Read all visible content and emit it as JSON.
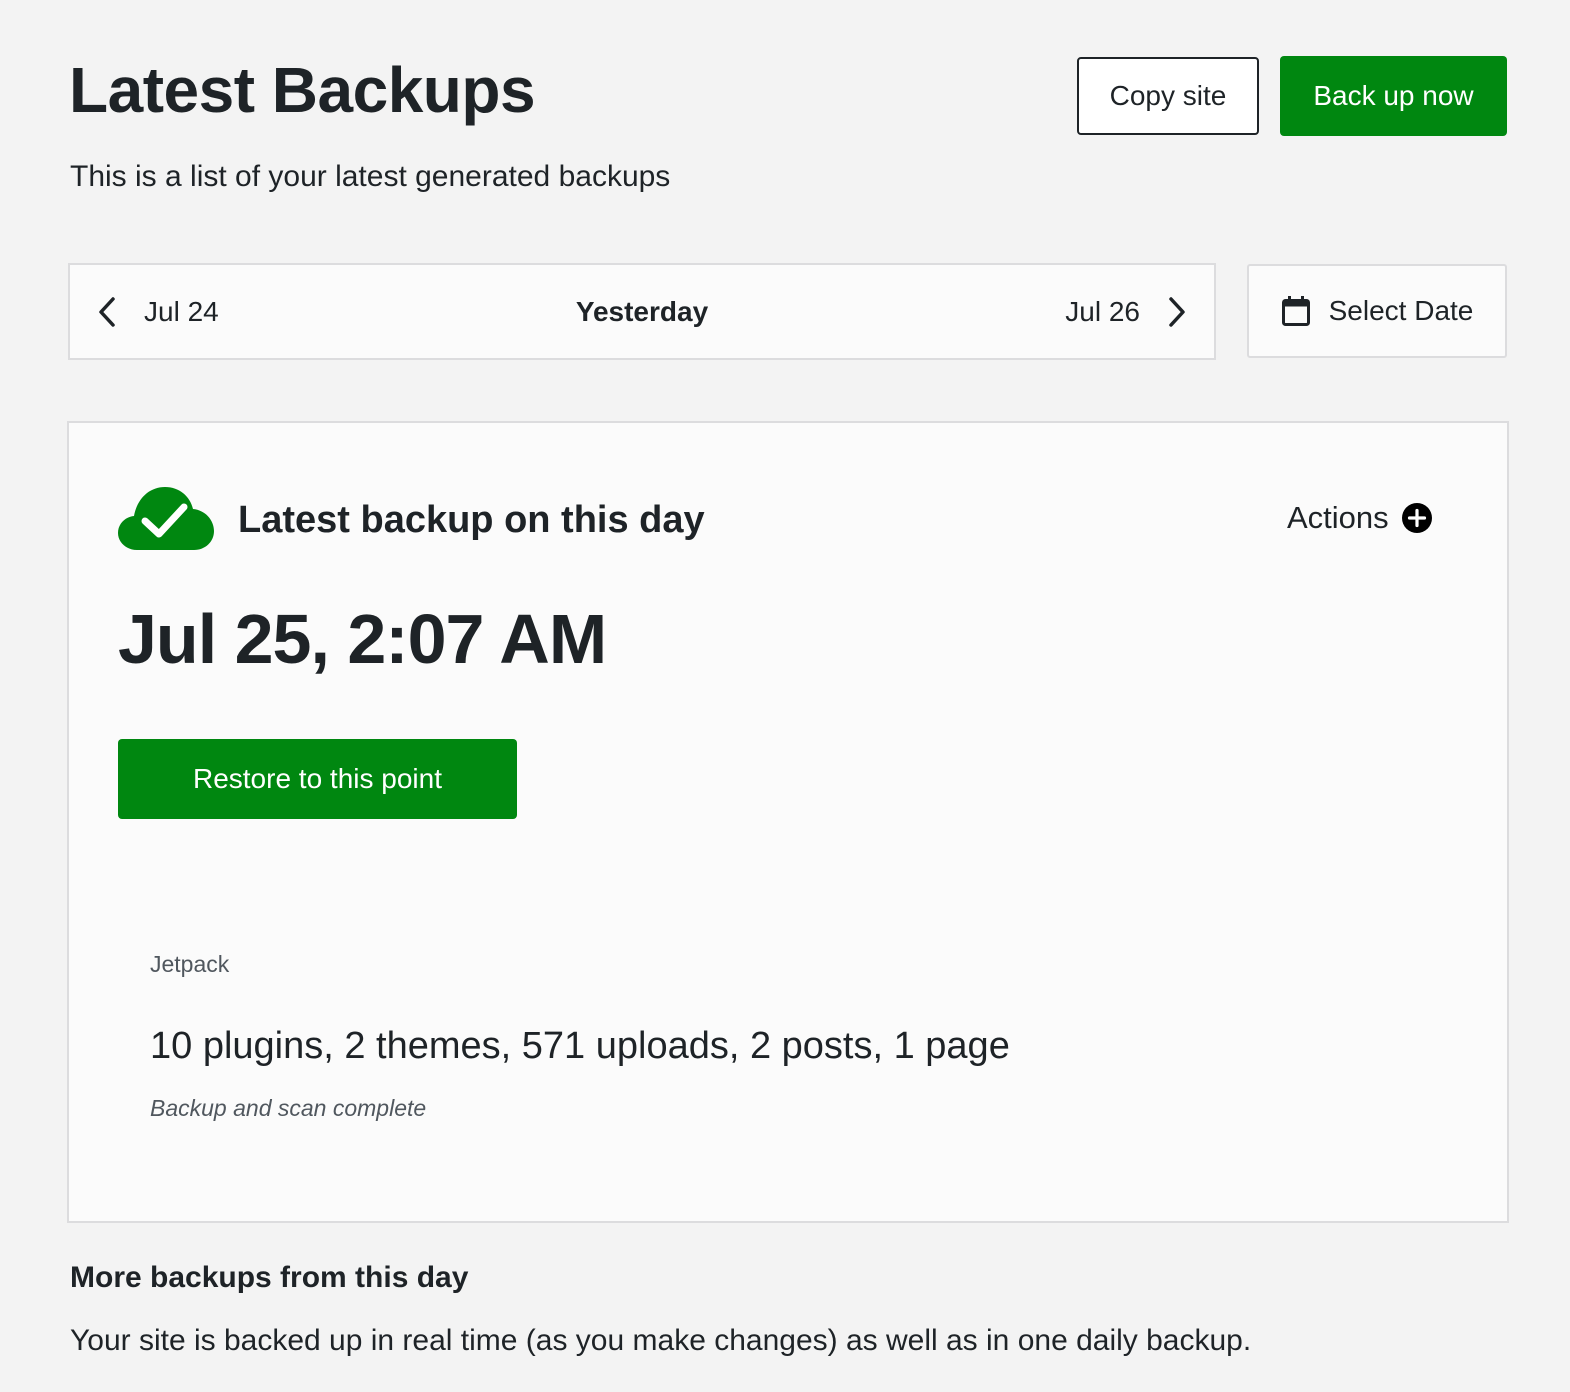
{
  "header": {
    "title": "Latest Backups",
    "subtitle": "This is a list of your latest generated backups",
    "copy_site_label": "Copy site",
    "back_up_now_label": "Back up now"
  },
  "date_nav": {
    "prev_label": "Jul 24",
    "current_label": "Yesterday",
    "next_label": "Jul 26",
    "select_date_label": "Select Date"
  },
  "backup_card": {
    "heading": "Latest backup on this day",
    "actions_label": "Actions",
    "timestamp": "Jul 25, 2:07 AM",
    "restore_label": "Restore to this point",
    "source": "Jetpack",
    "summary": "10 plugins, 2 themes, 571 uploads, 2 posts, 1 page",
    "status": "Backup and scan complete"
  },
  "more_backups": {
    "title": "More backups from this day",
    "description": "Your site is backed up in real time (as you make changes) as well as in one daily backup."
  },
  "colors": {
    "primary_green": "#008710",
    "text_dark": "#1e2327",
    "page_background": "#f3f3f3",
    "border": "#dcdcde"
  },
  "icons": {
    "prev": "chevron-left-icon",
    "next": "chevron-right-icon",
    "calendar": "calendar-icon",
    "status": "cloud-check-icon",
    "actions": "plus-circle-icon"
  }
}
